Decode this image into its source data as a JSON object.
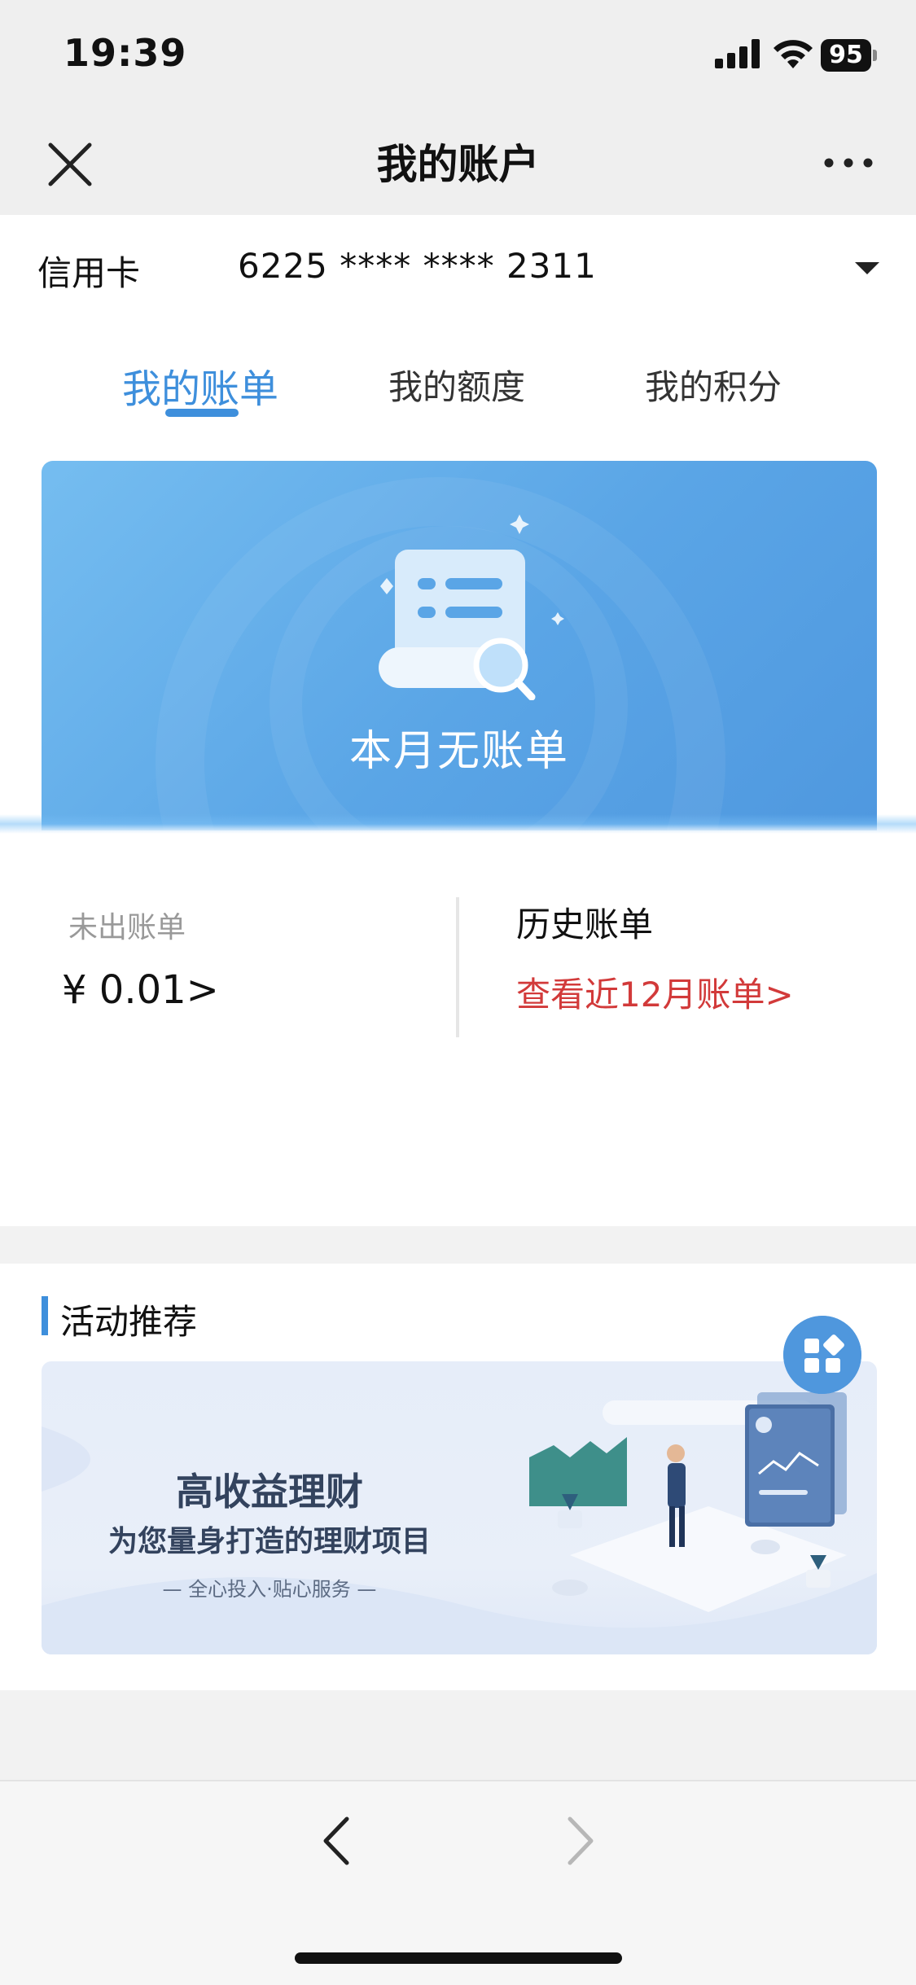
{
  "status_bar": {
    "time": "19:39",
    "battery": "95"
  },
  "nav": {
    "title": "我的账户"
  },
  "account": {
    "type": "信用卡",
    "number": "6225 **** **** 2311"
  },
  "tabs": [
    {
      "label": "我的账单",
      "active": true
    },
    {
      "label": "我的额度",
      "active": false
    },
    {
      "label": "我的积分",
      "active": false
    }
  ],
  "banner": {
    "message": "本月无账单"
  },
  "balances": {
    "unbilled_label": "未出账单",
    "unbilled_amount": "¥ 0.01>",
    "history_label": "历史账单",
    "history_link": "查看近12月账单>"
  },
  "activity": {
    "section_title": "活动推荐",
    "promo_title": "高收益理财",
    "promo_subtitle": "为您量身打造的理财项目",
    "promo_tagline": "— 全心投入·贴心服务 —"
  },
  "colors": {
    "accent": "#3e8fdc",
    "link_red": "#d23a3a",
    "banner_blue": "#5aa5e6"
  }
}
